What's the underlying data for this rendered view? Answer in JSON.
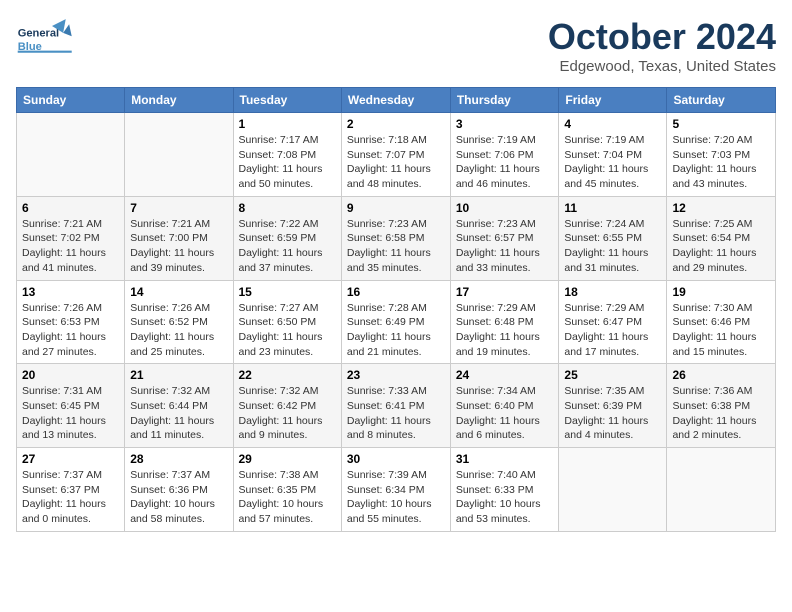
{
  "header": {
    "logo_general": "General",
    "logo_blue": "Blue",
    "month": "October 2024",
    "location": "Edgewood, Texas, United States"
  },
  "days_of_week": [
    "Sunday",
    "Monday",
    "Tuesday",
    "Wednesday",
    "Thursday",
    "Friday",
    "Saturday"
  ],
  "weeks": [
    [
      {
        "day": "",
        "sunrise": "",
        "sunset": "",
        "daylight": ""
      },
      {
        "day": "",
        "sunrise": "",
        "sunset": "",
        "daylight": ""
      },
      {
        "day": "1",
        "sunrise": "Sunrise: 7:17 AM",
        "sunset": "Sunset: 7:08 PM",
        "daylight": "Daylight: 11 hours and 50 minutes."
      },
      {
        "day": "2",
        "sunrise": "Sunrise: 7:18 AM",
        "sunset": "Sunset: 7:07 PM",
        "daylight": "Daylight: 11 hours and 48 minutes."
      },
      {
        "day": "3",
        "sunrise": "Sunrise: 7:19 AM",
        "sunset": "Sunset: 7:06 PM",
        "daylight": "Daylight: 11 hours and 46 minutes."
      },
      {
        "day": "4",
        "sunrise": "Sunrise: 7:19 AM",
        "sunset": "Sunset: 7:04 PM",
        "daylight": "Daylight: 11 hours and 45 minutes."
      },
      {
        "day": "5",
        "sunrise": "Sunrise: 7:20 AM",
        "sunset": "Sunset: 7:03 PM",
        "daylight": "Daylight: 11 hours and 43 minutes."
      }
    ],
    [
      {
        "day": "6",
        "sunrise": "Sunrise: 7:21 AM",
        "sunset": "Sunset: 7:02 PM",
        "daylight": "Daylight: 11 hours and 41 minutes."
      },
      {
        "day": "7",
        "sunrise": "Sunrise: 7:21 AM",
        "sunset": "Sunset: 7:00 PM",
        "daylight": "Daylight: 11 hours and 39 minutes."
      },
      {
        "day": "8",
        "sunrise": "Sunrise: 7:22 AM",
        "sunset": "Sunset: 6:59 PM",
        "daylight": "Daylight: 11 hours and 37 minutes."
      },
      {
        "day": "9",
        "sunrise": "Sunrise: 7:23 AM",
        "sunset": "Sunset: 6:58 PM",
        "daylight": "Daylight: 11 hours and 35 minutes."
      },
      {
        "day": "10",
        "sunrise": "Sunrise: 7:23 AM",
        "sunset": "Sunset: 6:57 PM",
        "daylight": "Daylight: 11 hours and 33 minutes."
      },
      {
        "day": "11",
        "sunrise": "Sunrise: 7:24 AM",
        "sunset": "Sunset: 6:55 PM",
        "daylight": "Daylight: 11 hours and 31 minutes."
      },
      {
        "day": "12",
        "sunrise": "Sunrise: 7:25 AM",
        "sunset": "Sunset: 6:54 PM",
        "daylight": "Daylight: 11 hours and 29 minutes."
      }
    ],
    [
      {
        "day": "13",
        "sunrise": "Sunrise: 7:26 AM",
        "sunset": "Sunset: 6:53 PM",
        "daylight": "Daylight: 11 hours and 27 minutes."
      },
      {
        "day": "14",
        "sunrise": "Sunrise: 7:26 AM",
        "sunset": "Sunset: 6:52 PM",
        "daylight": "Daylight: 11 hours and 25 minutes."
      },
      {
        "day": "15",
        "sunrise": "Sunrise: 7:27 AM",
        "sunset": "Sunset: 6:50 PM",
        "daylight": "Daylight: 11 hours and 23 minutes."
      },
      {
        "day": "16",
        "sunrise": "Sunrise: 7:28 AM",
        "sunset": "Sunset: 6:49 PM",
        "daylight": "Daylight: 11 hours and 21 minutes."
      },
      {
        "day": "17",
        "sunrise": "Sunrise: 7:29 AM",
        "sunset": "Sunset: 6:48 PM",
        "daylight": "Daylight: 11 hours and 19 minutes."
      },
      {
        "day": "18",
        "sunrise": "Sunrise: 7:29 AM",
        "sunset": "Sunset: 6:47 PM",
        "daylight": "Daylight: 11 hours and 17 minutes."
      },
      {
        "day": "19",
        "sunrise": "Sunrise: 7:30 AM",
        "sunset": "Sunset: 6:46 PM",
        "daylight": "Daylight: 11 hours and 15 minutes."
      }
    ],
    [
      {
        "day": "20",
        "sunrise": "Sunrise: 7:31 AM",
        "sunset": "Sunset: 6:45 PM",
        "daylight": "Daylight: 11 hours and 13 minutes."
      },
      {
        "day": "21",
        "sunrise": "Sunrise: 7:32 AM",
        "sunset": "Sunset: 6:44 PM",
        "daylight": "Daylight: 11 hours and 11 minutes."
      },
      {
        "day": "22",
        "sunrise": "Sunrise: 7:32 AM",
        "sunset": "Sunset: 6:42 PM",
        "daylight": "Daylight: 11 hours and 9 minutes."
      },
      {
        "day": "23",
        "sunrise": "Sunrise: 7:33 AM",
        "sunset": "Sunset: 6:41 PM",
        "daylight": "Daylight: 11 hours and 8 minutes."
      },
      {
        "day": "24",
        "sunrise": "Sunrise: 7:34 AM",
        "sunset": "Sunset: 6:40 PM",
        "daylight": "Daylight: 11 hours and 6 minutes."
      },
      {
        "day": "25",
        "sunrise": "Sunrise: 7:35 AM",
        "sunset": "Sunset: 6:39 PM",
        "daylight": "Daylight: 11 hours and 4 minutes."
      },
      {
        "day": "26",
        "sunrise": "Sunrise: 7:36 AM",
        "sunset": "Sunset: 6:38 PM",
        "daylight": "Daylight: 11 hours and 2 minutes."
      }
    ],
    [
      {
        "day": "27",
        "sunrise": "Sunrise: 7:37 AM",
        "sunset": "Sunset: 6:37 PM",
        "daylight": "Daylight: 11 hours and 0 minutes."
      },
      {
        "day": "28",
        "sunrise": "Sunrise: 7:37 AM",
        "sunset": "Sunset: 6:36 PM",
        "daylight": "Daylight: 10 hours and 58 minutes."
      },
      {
        "day": "29",
        "sunrise": "Sunrise: 7:38 AM",
        "sunset": "Sunset: 6:35 PM",
        "daylight": "Daylight: 10 hours and 57 minutes."
      },
      {
        "day": "30",
        "sunrise": "Sunrise: 7:39 AM",
        "sunset": "Sunset: 6:34 PM",
        "daylight": "Daylight: 10 hours and 55 minutes."
      },
      {
        "day": "31",
        "sunrise": "Sunrise: 7:40 AM",
        "sunset": "Sunset: 6:33 PM",
        "daylight": "Daylight: 10 hours and 53 minutes."
      },
      {
        "day": "",
        "sunrise": "",
        "sunset": "",
        "daylight": ""
      },
      {
        "day": "",
        "sunrise": "",
        "sunset": "",
        "daylight": ""
      }
    ]
  ]
}
